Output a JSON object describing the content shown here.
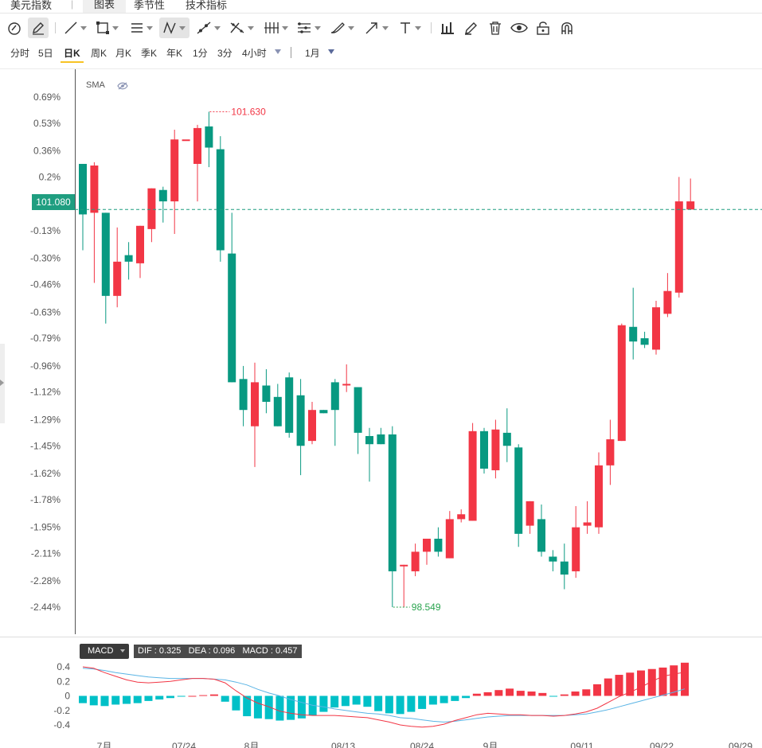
{
  "tabs": [
    {
      "label": "美元指数",
      "active": false
    },
    {
      "label": "图表",
      "active": true
    },
    {
      "label": "季节性",
      "active": false
    },
    {
      "label": "技术指标",
      "active": false
    }
  ],
  "toolbar": {
    "icons": [
      "cursor-icon",
      "pencil-icon",
      "line-icon",
      "rectangle-icon",
      "parallel-lines-icon",
      "zigzag-icon",
      "ray-icon",
      "cross-lines-icon",
      "fib-icon",
      "channel-icon",
      "brush-icon",
      "arrow-icon",
      "text-icon",
      "bar-chart-icon",
      "edit-icon",
      "trash-icon",
      "eye-icon",
      "lock-icon",
      "magnet-icon"
    ]
  },
  "periods": {
    "items": [
      "分时",
      "5日",
      "日K",
      "周K",
      "月K",
      "季K",
      "年K",
      "1分",
      "3分",
      "4小时"
    ],
    "active": "日K",
    "range": "1月"
  },
  "indicator": {
    "name": "SMA"
  },
  "price_marker": {
    "current": "101.080",
    "high_label": "101.630",
    "low_label": "98.549"
  },
  "macd": {
    "name": "MACD",
    "values_text": "DIF : 0.325   DEA : 0.096   MACD : 0.457"
  },
  "colors": {
    "up": "#f23645",
    "down": "#089981",
    "macd_pos": "#f23645",
    "macd_neg": "#00c0c7",
    "dif": "#f23645",
    "dea": "#5ab4e5"
  },
  "chart_data": {
    "type": "candlestick",
    "price_axis_labels": [
      "0.69%",
      "0.53%",
      "0.36%",
      "0.2%",
      "-0.13%",
      "-0.30%",
      "-0.46%",
      "-0.63%",
      "-0.79%",
      "-0.96%",
      "-1.12%",
      "-1.29%",
      "-1.45%",
      "-1.62%",
      "-1.78%",
      "-1.95%",
      "-2.11%",
      "-2.28%",
      "-2.44%"
    ],
    "price_axis_values": [
      0.69,
      0.53,
      0.36,
      0.2,
      -0.13,
      -0.3,
      -0.46,
      -0.63,
      -0.79,
      -0.96,
      -1.12,
      -1.29,
      -1.45,
      -1.62,
      -1.78,
      -1.95,
      -2.11,
      -2.28,
      -2.44
    ],
    "ylim": [
      -2.5,
      0.8
    ],
    "base_price": 101.08,
    "x_labels": [
      "7月",
      "07/24",
      "8月",
      "08/13",
      "08/24",
      "9月",
      "09/11",
      "09/22",
      "09/29"
    ],
    "candles": [
      {
        "o": 0.28,
        "c": -0.03,
        "h": 0.28,
        "l": -0.25
      },
      {
        "o": -0.02,
        "c": 0.27,
        "h": 0.29,
        "l": -0.45
      },
      {
        "o": -0.02,
        "c": -0.53,
        "h": -0.02,
        "l": -0.7
      },
      {
        "o": -0.53,
        "c": -0.32,
        "h": -0.11,
        "l": -0.6
      },
      {
        "o": -0.28,
        "c": -0.32,
        "h": -0.2,
        "l": -0.43
      },
      {
        "o": -0.33,
        "c": -0.1,
        "h": -0.1,
        "l": -0.42
      },
      {
        "o": -0.12,
        "c": 0.13,
        "h": 0.13,
        "l": -0.2
      },
      {
        "o": 0.12,
        "c": 0.05,
        "h": 0.14,
        "l": -0.08
      },
      {
        "o": 0.05,
        "c": 0.43,
        "h": 0.49,
        "l": -0.15
      },
      {
        "o": 0.43,
        "c": 0.43,
        "h": 0.43,
        "l": 0.43
      },
      {
        "o": 0.28,
        "c": 0.5,
        "h": 0.52,
        "l": 0.05
      },
      {
        "o": 0.51,
        "c": 0.38,
        "h": 0.6,
        "l": 0.26
      },
      {
        "o": 0.37,
        "c": -0.25,
        "h": 0.45,
        "l": -0.32
      },
      {
        "o": -0.27,
        "c": -1.06,
        "h": -0.02,
        "l": -1.06
      },
      {
        "o": -1.04,
        "c": -1.23,
        "h": -0.96,
        "l": -1.33
      },
      {
        "o": -1.33,
        "c": -1.06,
        "h": -0.94,
        "l": -1.58
      },
      {
        "o": -1.08,
        "c": -1.18,
        "h": -0.98,
        "l": -1.25
      },
      {
        "o": -1.15,
        "c": -1.33,
        "h": -1.07,
        "l": -1.33
      },
      {
        "o": -1.03,
        "c": -1.37,
        "h": -1.0,
        "l": -1.4
      },
      {
        "o": -1.14,
        "c": -1.45,
        "h": -1.04,
        "l": -1.63
      },
      {
        "o": -1.42,
        "c": -1.23,
        "h": -1.18,
        "l": -1.44
      },
      {
        "o": -1.23,
        "c": -1.25,
        "h": -1.23,
        "l": -1.25
      },
      {
        "o": -1.06,
        "c": -1.23,
        "h": -1.04,
        "l": -1.45
      },
      {
        "o": -1.07,
        "c": -1.07,
        "h": -0.95,
        "l": -1.12
      },
      {
        "o": -1.09,
        "c": -1.37,
        "h": -1.09,
        "l": -1.5
      },
      {
        "o": -1.39,
        "c": -1.44,
        "h": -1.34,
        "l": -1.67
      },
      {
        "o": -1.38,
        "c": -1.44,
        "h": -1.34,
        "l": -1.44
      },
      {
        "o": -1.38,
        "c": -2.22,
        "h": -1.33,
        "l": -2.44
      },
      {
        "o": -2.18,
        "c": -2.18,
        "h": -2.18,
        "l": -2.44
      },
      {
        "o": -2.22,
        "c": -2.1,
        "h": -2.05,
        "l": -2.25
      },
      {
        "o": -2.1,
        "c": -2.02,
        "h": -2.02,
        "l": -2.18
      },
      {
        "o": -2.02,
        "c": -2.1,
        "h": -1.95,
        "l": -2.13
      },
      {
        "o": -2.14,
        "c": -1.9,
        "h": -1.85,
        "l": -2.14
      },
      {
        "o": -1.9,
        "c": -1.87,
        "h": -1.84,
        "l": -1.92
      },
      {
        "o": -1.91,
        "c": -1.36,
        "h": -1.31,
        "l": -1.91
      },
      {
        "o": -1.36,
        "c": -1.59,
        "h": -1.34,
        "l": -1.62
      },
      {
        "o": -1.6,
        "c": -1.35,
        "h": -1.29,
        "l": -1.65
      },
      {
        "o": -1.37,
        "c": -1.45,
        "h": -1.22,
        "l": -1.55
      },
      {
        "o": -1.46,
        "c": -1.99,
        "h": -1.44,
        "l": -2.07
      },
      {
        "o": -1.94,
        "c": -1.79,
        "h": -1.79,
        "l": -1.99
      },
      {
        "o": -1.9,
        "c": -2.1,
        "h": -1.81,
        "l": -2.13
      },
      {
        "o": -2.13,
        "c": -2.16,
        "h": -2.09,
        "l": -2.22
      },
      {
        "o": -2.16,
        "c": -2.24,
        "h": -2.05,
        "l": -2.33
      },
      {
        "o": -2.22,
        "c": -1.95,
        "h": -1.82,
        "l": -2.26
      },
      {
        "o": -1.94,
        "c": -1.92,
        "h": -1.79,
        "l": -1.99
      },
      {
        "o": -1.95,
        "c": -1.57,
        "h": -1.49,
        "l": -1.99
      },
      {
        "o": -1.57,
        "c": -1.41,
        "h": -1.29,
        "l": -1.69
      },
      {
        "o": -1.42,
        "c": -0.71,
        "h": -0.7,
        "l": -1.42
      },
      {
        "o": -0.72,
        "c": -0.81,
        "h": -0.48,
        "l": -0.92
      },
      {
        "o": -0.79,
        "c": -0.83,
        "h": -0.75,
        "l": -0.85
      },
      {
        "o": -0.86,
        "c": -0.6,
        "h": -0.56,
        "l": -0.89
      },
      {
        "o": -0.64,
        "c": -0.5,
        "h": -0.39,
        "l": -0.66
      },
      {
        "o": -0.51,
        "c": 0.05,
        "h": 0.2,
        "l": -0.54
      },
      {
        "o": 0.0,
        "c": 0.05,
        "h": 0.19,
        "l": 0.0
      }
    ],
    "macd_axis_labels": [
      "0.4",
      "0.2",
      "0",
      "-0.2",
      "-0.4"
    ],
    "macd_axis_values": [
      0.4,
      0.2,
      0,
      -0.2,
      -0.4
    ],
    "macd_ylim": [
      -0.45,
      0.5
    ],
    "macd_hist": [
      -0.1,
      -0.13,
      -0.14,
      -0.12,
      -0.11,
      -0.1,
      -0.07,
      -0.05,
      -0.03,
      -0.01,
      0,
      0.01,
      0.02,
      -0.08,
      -0.2,
      -0.28,
      -0.31,
      -0.32,
      -0.34,
      -0.33,
      -0.31,
      -0.27,
      -0.22,
      -0.16,
      -0.14,
      -0.12,
      -0.15,
      -0.21,
      -0.24,
      -0.25,
      -0.22,
      -0.18,
      -0.12,
      -0.1,
      -0.07,
      -0.03,
      0.03,
      0.05,
      0.08,
      0.1,
      0.07,
      0.06,
      0.04,
      -0.01,
      0.02,
      0.06,
      0.09,
      0.16,
      0.24,
      0.29,
      0.32,
      0.35,
      0.37,
      0.39,
      0.42,
      0.457
    ],
    "macd_dif": [
      0.4,
      0.38,
      0.32,
      0.27,
      0.22,
      0.19,
      0.18,
      0.19,
      0.2,
      0.22,
      0.24,
      0.24,
      0.23,
      0.18,
      0.07,
      -0.03,
      -0.1,
      -0.15,
      -0.21,
      -0.24,
      -0.26,
      -0.27,
      -0.27,
      -0.27,
      -0.28,
      -0.29,
      -0.3,
      -0.33,
      -0.36,
      -0.4,
      -0.42,
      -0.43,
      -0.42,
      -0.39,
      -0.34,
      -0.3,
      -0.26,
      -0.24,
      -0.25,
      -0.26,
      -0.26,
      -0.27,
      -0.27,
      -0.28,
      -0.27,
      -0.25,
      -0.22,
      -0.17,
      -0.09,
      -0.01,
      0.05,
      0.12,
      0.2,
      0.27,
      0.3,
      0.325
    ],
    "macd_dea": [
      0.38,
      0.37,
      0.35,
      0.32,
      0.3,
      0.28,
      0.26,
      0.25,
      0.24,
      0.24,
      0.24,
      0.24,
      0.23,
      0.22,
      0.19,
      0.15,
      0.09,
      0.04,
      0.0,
      -0.05,
      -0.09,
      -0.13,
      -0.15,
      -0.18,
      -0.2,
      -0.22,
      -0.24,
      -0.25,
      -0.27,
      -0.3,
      -0.31,
      -0.33,
      -0.35,
      -0.36,
      -0.35,
      -0.33,
      -0.31,
      -0.29,
      -0.28,
      -0.27,
      -0.27,
      -0.27,
      -0.27,
      -0.27,
      -0.27,
      -0.26,
      -0.25,
      -0.22,
      -0.19,
      -0.15,
      -0.11,
      -0.07,
      -0.03,
      0.01,
      0.05,
      0.096
    ]
  }
}
